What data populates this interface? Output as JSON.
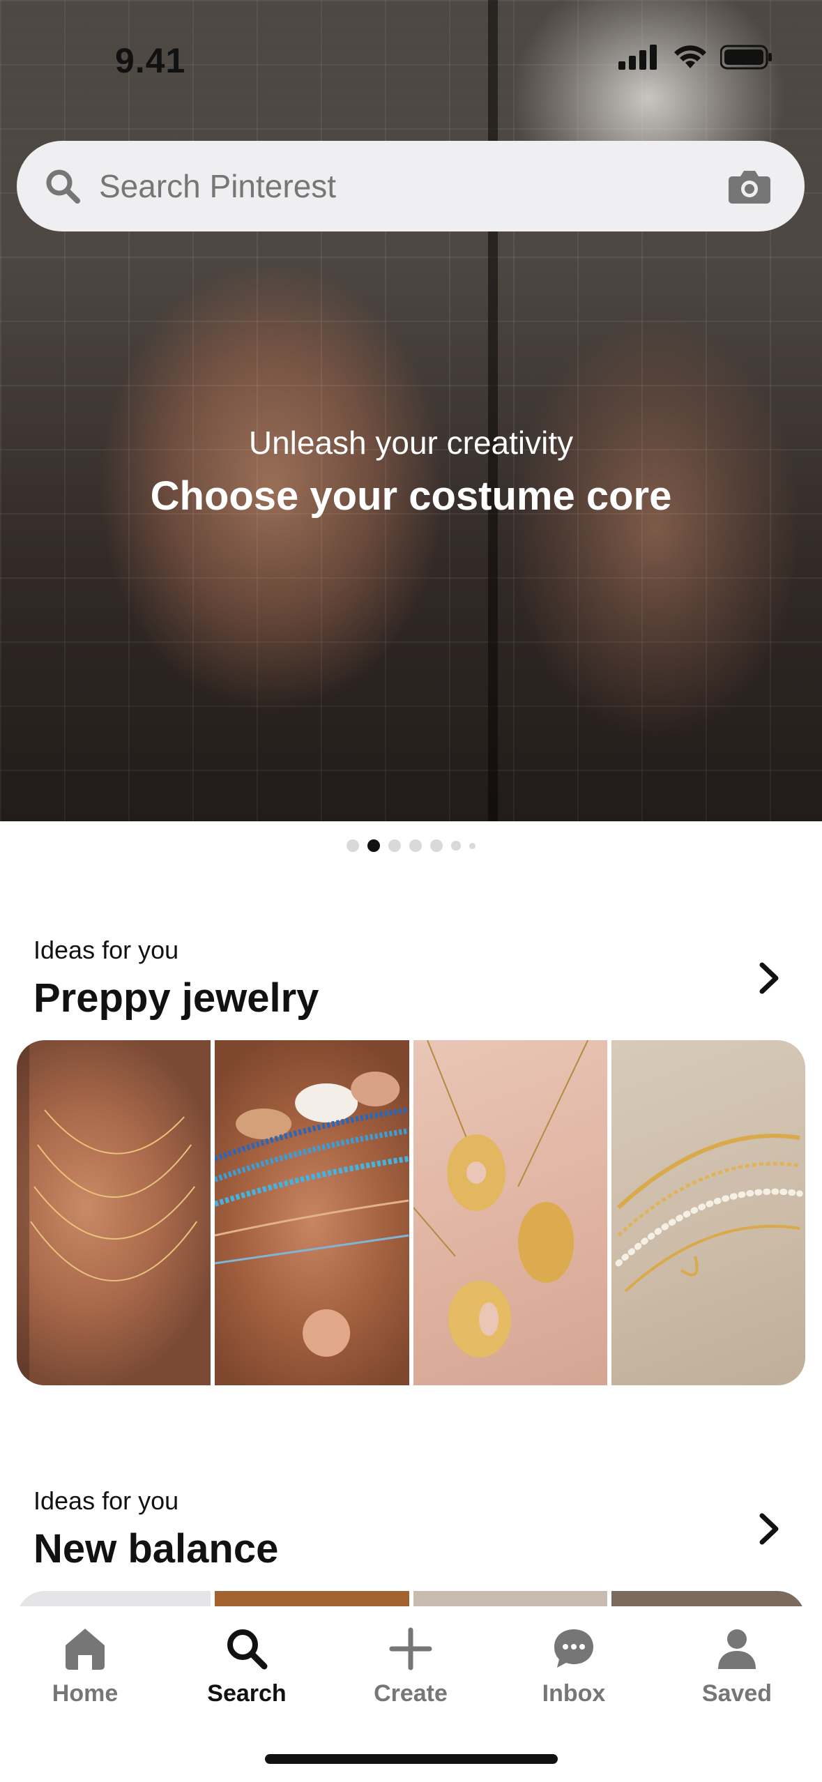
{
  "status_bar": {
    "time": "9.41"
  },
  "search": {
    "placeholder": "Search Pinterest"
  },
  "hero": {
    "subtitle": "Unleash your creativity",
    "title": "Choose your costume core",
    "carousel_pages": 7,
    "active_page": 2
  },
  "sections": [
    {
      "kicker": "Ideas for you",
      "title": "Preppy jewelry",
      "images": [
        "gold-layered-necklaces",
        "shell-and-bead-necklaces",
        "bubble-letter-pendants",
        "pearl-and-chain-bracelets"
      ]
    },
    {
      "kicker": "Ideas for you",
      "title": "New balance"
    }
  ],
  "tabbar": {
    "items": [
      {
        "label": "Home",
        "icon": "home-icon"
      },
      {
        "label": "Search",
        "icon": "search-icon",
        "active": true
      },
      {
        "label": "Create",
        "icon": "plus-icon"
      },
      {
        "label": "Inbox",
        "icon": "chat-bubble-icon"
      },
      {
        "label": "Saved",
        "icon": "profile-icon"
      }
    ]
  },
  "colors": {
    "text": "#111111",
    "muted": "#767676",
    "search_bg": "#efeef0"
  }
}
